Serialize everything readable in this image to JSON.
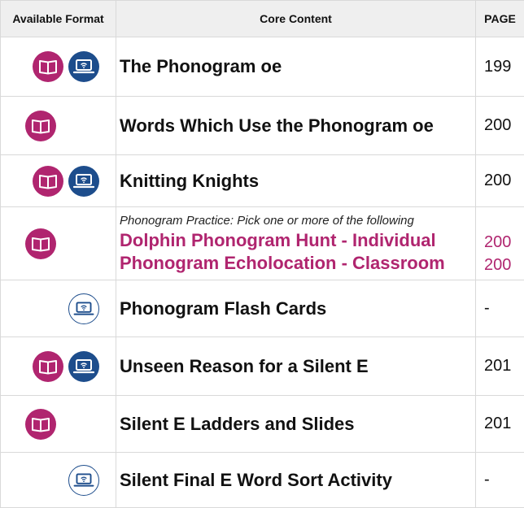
{
  "header": {
    "format": "Available Format",
    "content": "Core Content",
    "page": "PAGE"
  },
  "rows": [
    {
      "title": "The Phonogram oe",
      "page": "199"
    },
    {
      "title": "Words Which Use the Phonogram oe",
      "page": "200"
    },
    {
      "title": "Knitting Knights",
      "page": "200"
    },
    {
      "note": "Phonogram Practice: Pick one or more of the following",
      "options": [
        {
          "title": "Dolphin Phonogram Hunt - Individual",
          "page": "200"
        },
        {
          "title": "Phonogram Echolocation  - Classroom",
          "page": "200"
        }
      ]
    },
    {
      "title": "Phonogram Flash Cards",
      "page": "-"
    },
    {
      "title": "Unseen Reason for a Silent E",
      "page": "201"
    },
    {
      "title": "Silent E Ladders and Slides",
      "page": "201"
    },
    {
      "title": "Silent Final E Word Sort Activity",
      "page": "-"
    }
  ],
  "icons": {
    "book": "open-book-icon",
    "laptop": "laptop-wifi-icon"
  },
  "colors": {
    "magenta": "#b0256f",
    "navy": "#1d4d8c",
    "header_bg": "#efefef"
  }
}
